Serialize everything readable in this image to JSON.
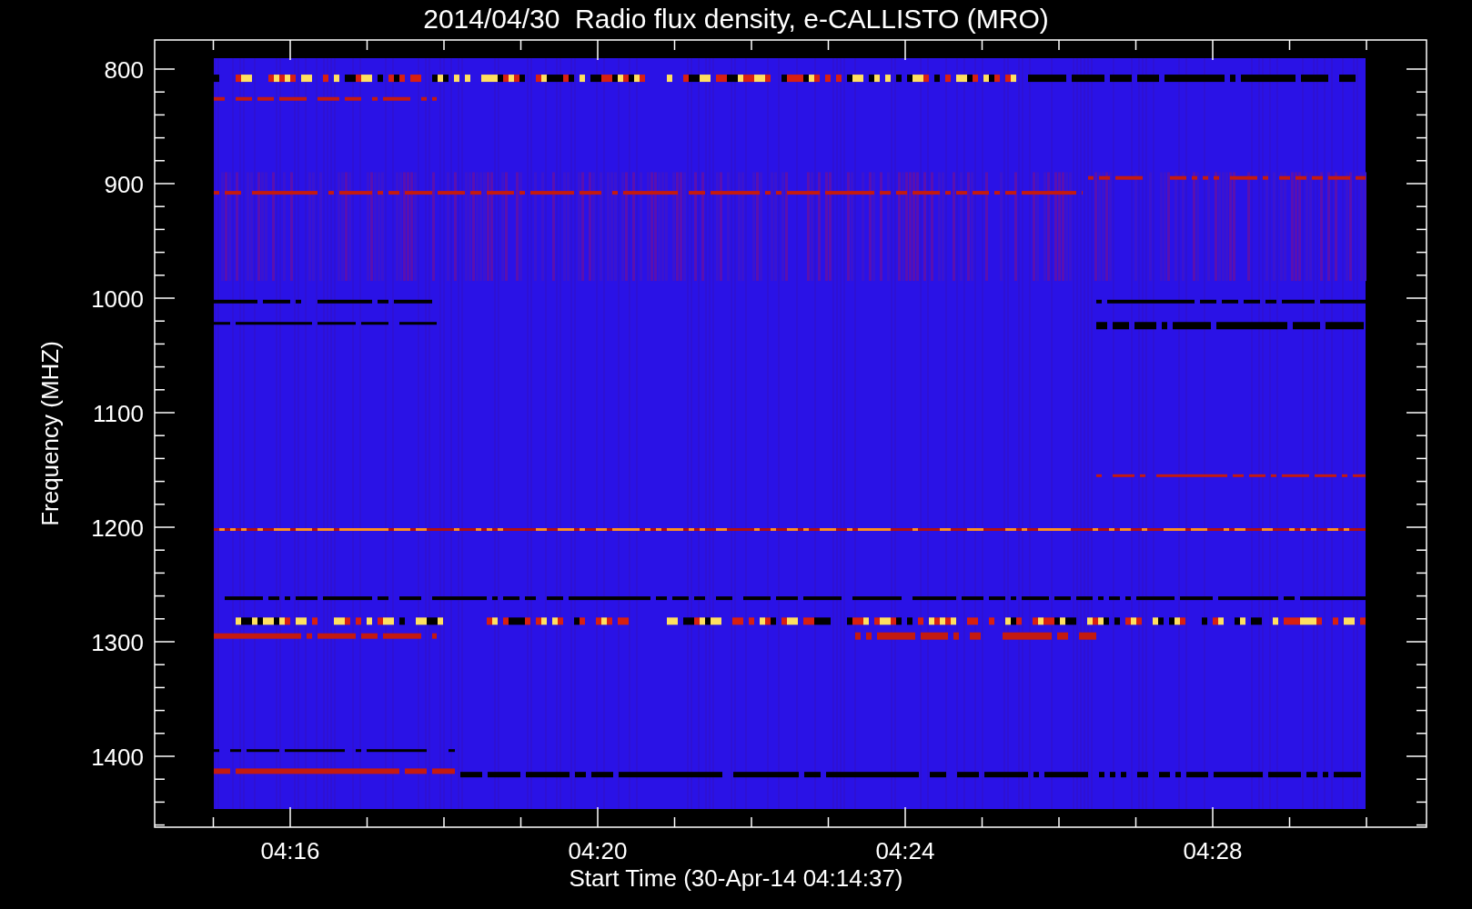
{
  "title": "2014/04/30  Radio flux density, e-CALLISTO (MRO)",
  "y_axis": {
    "label": "Frequency (MHZ)",
    "ticks": [
      "800",
      "900",
      "1000",
      "1100",
      "1200",
      "1300",
      "1400"
    ]
  },
  "x_axis": {
    "label": "Start Time (30-Apr-14 04:14:37)",
    "ticks": [
      "04:16",
      "04:20",
      "04:24",
      "04:28"
    ]
  }
}
